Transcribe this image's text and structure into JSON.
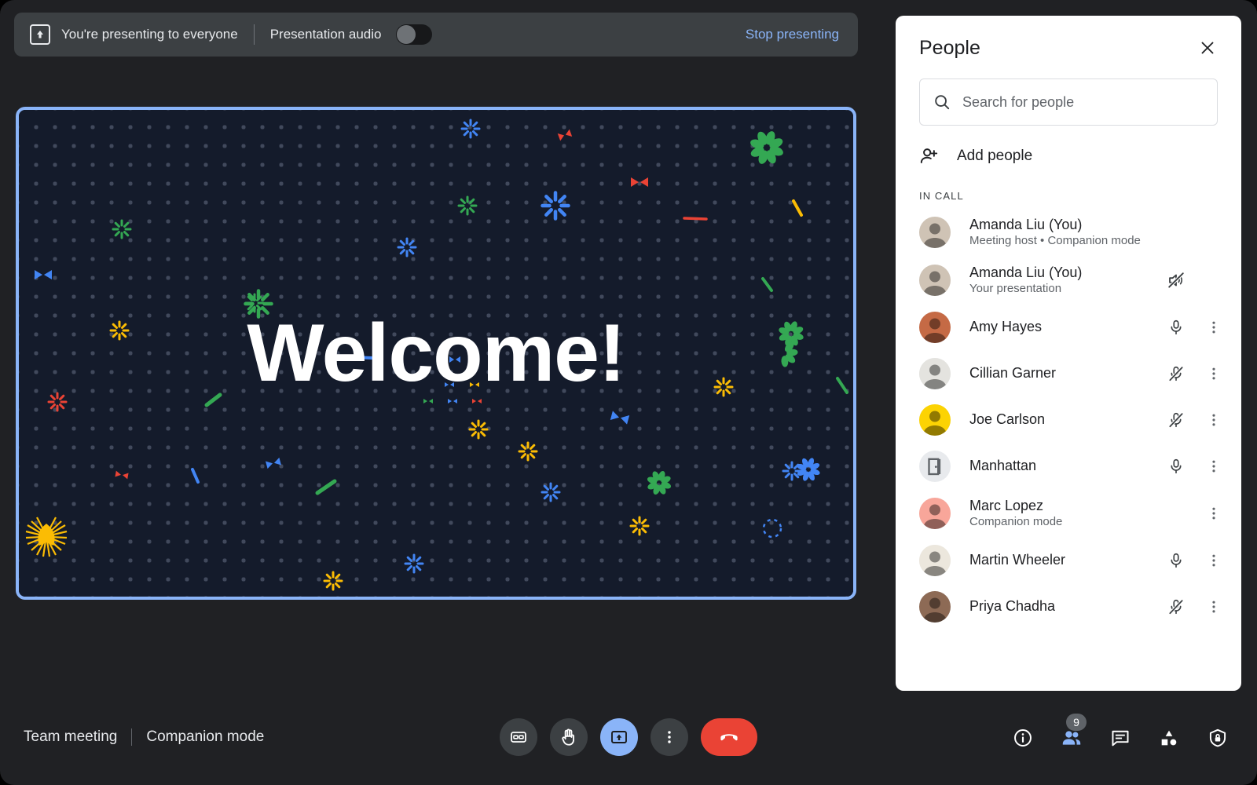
{
  "presenting_bar": {
    "icon": "present-to-all-icon",
    "status_text": "You're presenting to everyone",
    "audio_label": "Presentation audio",
    "audio_toggle_on": false,
    "stop_label": "Stop presenting",
    "accent": "#8ab4f8"
  },
  "stage": {
    "headline": "Welcome!",
    "border_color": "#8ab4f8",
    "background": "#141b2b",
    "dot_color": "#41495c"
  },
  "bottom_bar": {
    "meeting_name": "Team meeting",
    "mode_label": "Companion mode",
    "controls": [
      {
        "name": "captions-button",
        "icon": "closed-caption-icon",
        "active": false
      },
      {
        "name": "raise-hand-button",
        "icon": "raised-hand-icon",
        "active": false
      },
      {
        "name": "present-now-button",
        "icon": "present-to-all-icon",
        "active": true
      },
      {
        "name": "more-options-button",
        "icon": "more-vert-icon",
        "active": false
      },
      {
        "name": "leave-call-button",
        "icon": "call-end-icon",
        "active": false
      }
    ],
    "right_icons": [
      {
        "name": "meeting-details-button",
        "icon": "info-icon",
        "badge": null,
        "active": false
      },
      {
        "name": "show-everyone-button",
        "icon": "people-icon",
        "badge": "9",
        "active": true
      },
      {
        "name": "chat-button",
        "icon": "chat-bubble-icon",
        "badge": null,
        "active": false
      },
      {
        "name": "activities-button",
        "icon": "activities-shapes-icon",
        "badge": null,
        "active": false
      },
      {
        "name": "host-controls-button",
        "icon": "shield-lock-icon",
        "badge": null,
        "active": false
      }
    ]
  },
  "people_panel": {
    "title": "People",
    "close_icon": "close-icon",
    "search": {
      "icon": "search-icon",
      "placeholder": "Search for people",
      "value": ""
    },
    "add_people": {
      "icon": "person-add-icon",
      "label": "Add people"
    },
    "section_label": "IN CALL",
    "participants": [
      {
        "name": "Amanda Liu (You)",
        "subtitle": "Meeting host • Companion mode",
        "avatar_type": "photo",
        "avatar_color": "#cfc3b5",
        "mic_icon": null,
        "has_more": false
      },
      {
        "name": "Amanda Liu (You)",
        "subtitle": "Your presentation",
        "avatar_type": "photo",
        "avatar_color": "#cfc3b5",
        "mic_icon": "volume-off-icon",
        "has_more": false
      },
      {
        "name": "Amy Hayes",
        "subtitle": "",
        "avatar_type": "photo",
        "avatar_color": "#c56a45",
        "mic_icon": "mic-on-icon",
        "has_more": true
      },
      {
        "name": "Cillian Garner",
        "subtitle": "",
        "avatar_type": "photo",
        "avatar_color": "#e4e3df",
        "mic_icon": "mic-off-icon",
        "has_more": true
      },
      {
        "name": "Joe Carlson",
        "subtitle": "",
        "avatar_type": "photo",
        "avatar_color": "#fcd303",
        "mic_icon": "mic-off-icon",
        "has_more": true
      },
      {
        "name": "Manhattan",
        "subtitle": "",
        "avatar_type": "room",
        "avatar_color": "#dadce0",
        "mic_icon": "mic-on-icon",
        "has_more": true
      },
      {
        "name": "Marc Lopez",
        "subtitle": "Companion mode",
        "avatar_type": "photo",
        "avatar_color": "#f8a69a",
        "mic_icon": null,
        "has_more": true
      },
      {
        "name": "Martin Wheeler",
        "subtitle": "",
        "avatar_type": "photo",
        "avatar_color": "#ece7dd",
        "mic_icon": "mic-on-icon",
        "has_more": true
      },
      {
        "name": "Priya Chadha",
        "subtitle": "",
        "avatar_type": "photo",
        "avatar_color": "#8d6a55",
        "mic_icon": "mic-off-icon",
        "has_more": true
      }
    ]
  }
}
